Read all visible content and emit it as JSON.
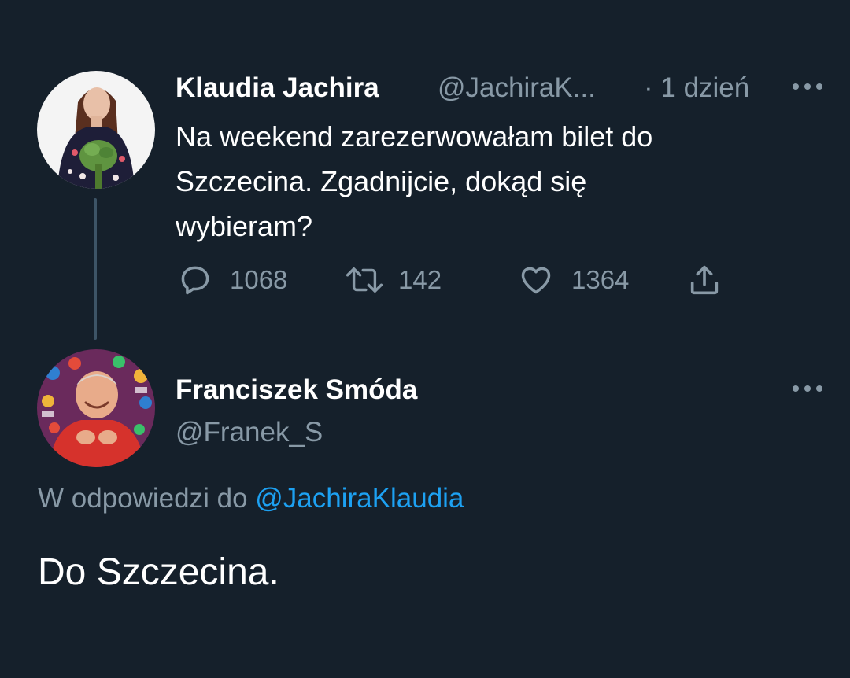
{
  "original_tweet": {
    "author_name": "Klaudia Jachira",
    "handle": "@JachiraK...",
    "time": "· 1 dzień",
    "text_lines": [
      "Na weekend zarezerwowałam bilet do",
      "Szczecina. Zgadnijcie, dokąd się",
      "wybieram?"
    ],
    "actions": {
      "reply_count": "1068",
      "retweet_count": "142",
      "like_count": "1364",
      "reply_icon": "reply-icon",
      "retweet_icon": "retweet-icon",
      "like_icon": "heart-icon",
      "share_icon": "share-icon"
    },
    "more_icon": "more-icon"
  },
  "reply_tweet": {
    "author_name": "Franciszek Smóda",
    "handle": "@Franek_S",
    "reply_context_prefix": "W odpowiedzi do",
    "reply_context_mention": "@JachiraKlaudia",
    "text": "Do Szczecina.",
    "more_icon": "more-icon"
  },
  "colors": {
    "background": "#15202b",
    "text_primary": "#ffffff",
    "text_secondary": "#8899a6",
    "link": "#1da1f2",
    "thread_line": "#3d5466"
  }
}
